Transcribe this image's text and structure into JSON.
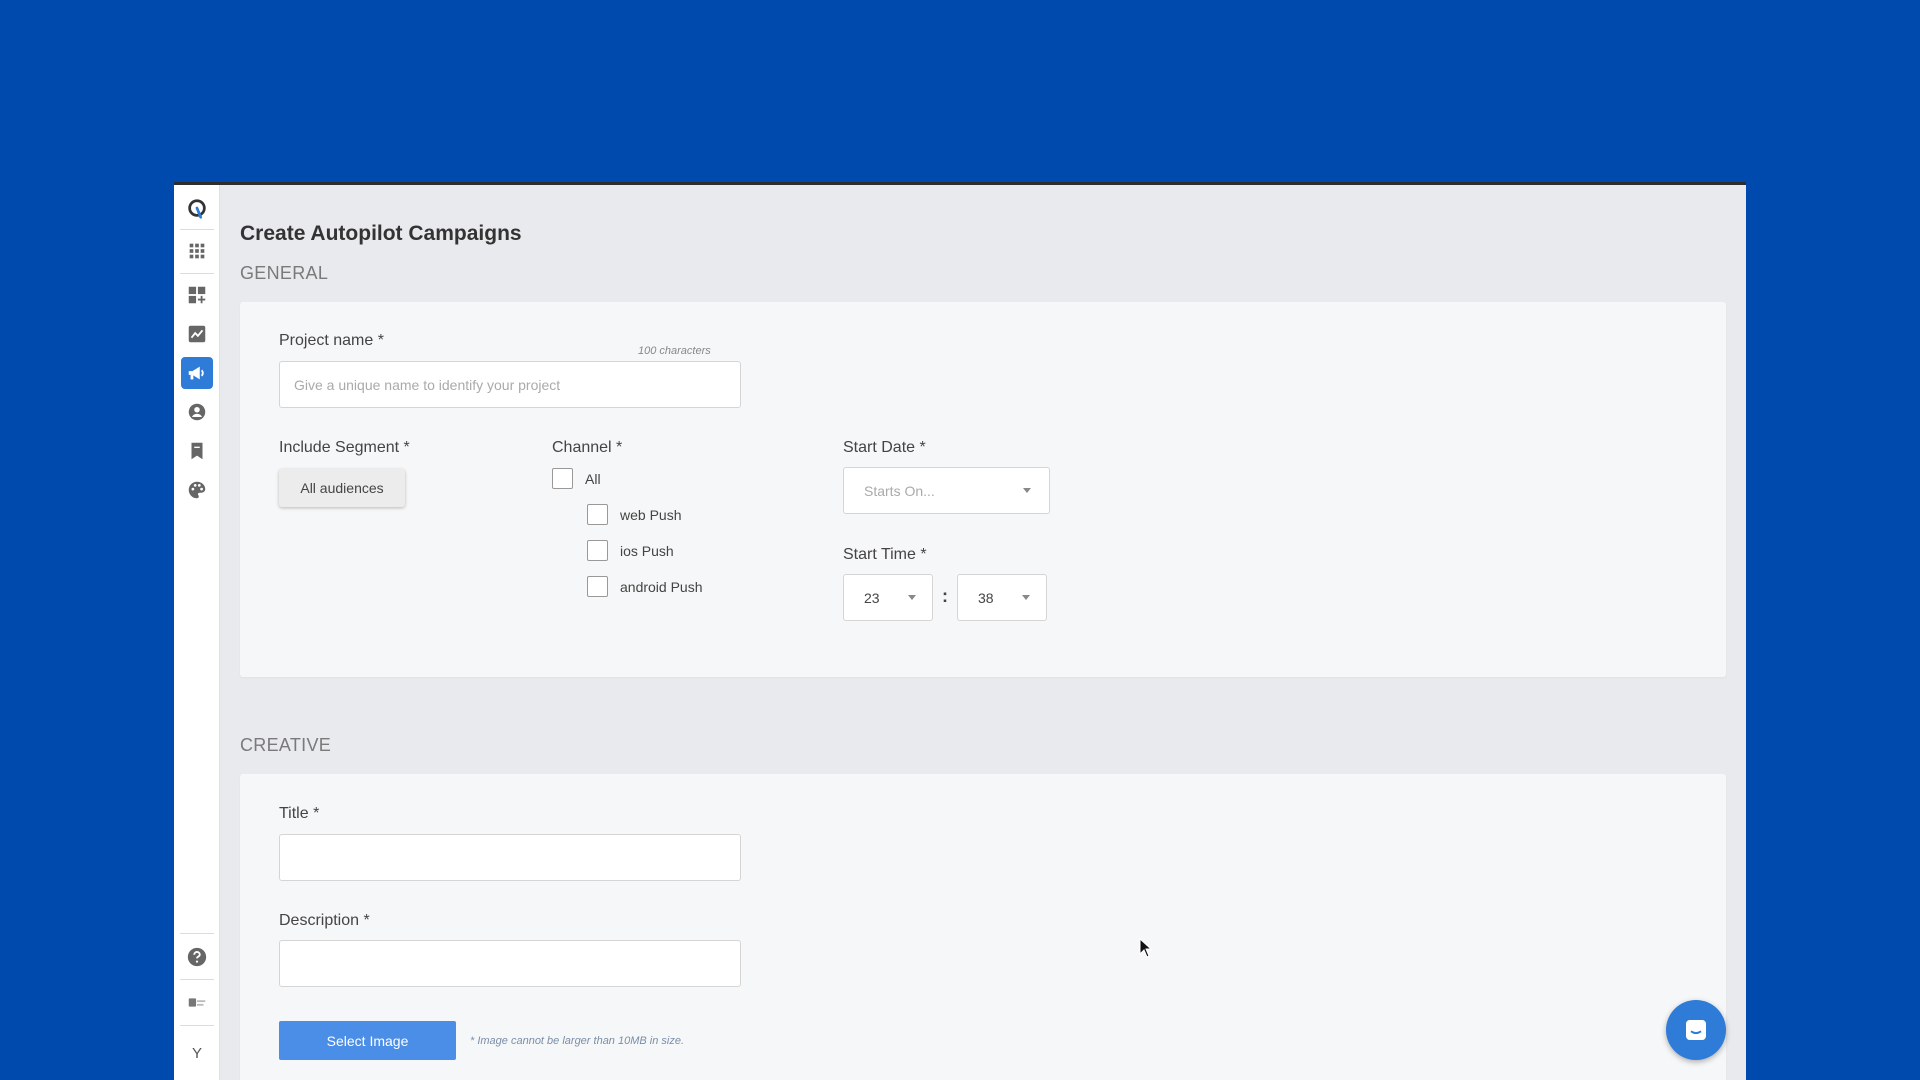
{
  "page": {
    "title": "Create Autopilot Campaigns"
  },
  "sidebar": {
    "items": [
      {
        "icon": "app-logo-icon"
      },
      {
        "icon": "apps-grid-icon"
      },
      {
        "icon": "dashboard-add-icon"
      },
      {
        "icon": "analytics-chart-icon"
      },
      {
        "icon": "megaphone-icon",
        "active": true
      },
      {
        "icon": "user-circle-icon"
      },
      {
        "icon": "bookmark-icon"
      },
      {
        "icon": "palette-icon"
      }
    ],
    "bottom": {
      "help_icon": "help-circle-icon",
      "brand_icon": "brand-badge-icon",
      "user_initial": "Y"
    }
  },
  "general": {
    "section_label": "GENERAL",
    "project_name": {
      "label": "Project name *",
      "hint": "100 characters",
      "placeholder": "Give a unique name to identify your project",
      "value": ""
    },
    "segment": {
      "label": "Include Segment *",
      "button_label": "All audiences"
    },
    "channel": {
      "label": "Channel *",
      "options": [
        {
          "label": "All",
          "checked": false
        },
        {
          "label": "web Push",
          "checked": false
        },
        {
          "label": "ios Push",
          "checked": false
        },
        {
          "label": "android Push",
          "checked": false
        }
      ]
    },
    "start_date": {
      "label": "Start Date *",
      "placeholder": "Starts On..."
    },
    "start_time": {
      "label": "Start Time *",
      "hour": "23",
      "separator": ":",
      "minute": "38"
    }
  },
  "creative": {
    "section_label": "CREATIVE",
    "title_field": {
      "label": "Title *",
      "value": ""
    },
    "description_field": {
      "label": "Description *",
      "value": ""
    },
    "select_image": {
      "button_label": "Select Image",
      "note": "* Image cannot be larger than 10MB in size."
    }
  },
  "colors": {
    "background": "#004aad",
    "accent": "#2e7bd8",
    "primary_button": "#4b8ee8"
  }
}
